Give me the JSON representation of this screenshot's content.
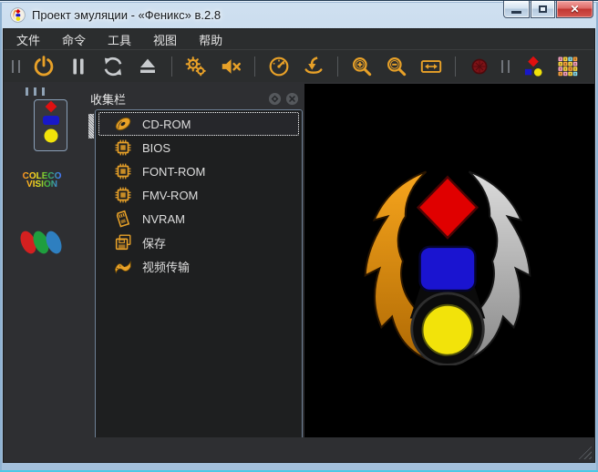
{
  "window": {
    "title": "Проект эмуляции - «Феникс» в.2.8",
    "app_icon": "phoenix-app-icon",
    "controls": [
      {
        "name": "minimize",
        "icon": "minimize-icon"
      },
      {
        "name": "maximize",
        "icon": "maximize-icon"
      },
      {
        "name": "close",
        "icon": "close-icon"
      }
    ]
  },
  "menu_bar": {
    "items": [
      {
        "label": "文件"
      },
      {
        "label": "命令"
      },
      {
        "label": "工具"
      },
      {
        "label": "视图"
      },
      {
        "label": "帮助"
      }
    ]
  },
  "toolbar": {
    "items": [
      {
        "type": "grip"
      },
      {
        "type": "button",
        "name": "power",
        "icon": "power-icon"
      },
      {
        "type": "button",
        "name": "pause",
        "icon": "pause-icon"
      },
      {
        "type": "button",
        "name": "reset",
        "icon": "refresh-icon"
      },
      {
        "type": "button",
        "name": "eject",
        "icon": "eject-icon"
      },
      {
        "type": "separator"
      },
      {
        "type": "button",
        "name": "settings",
        "icon": "gears-icon"
      },
      {
        "type": "button",
        "name": "mute",
        "icon": "mute-icon"
      },
      {
        "type": "separator"
      },
      {
        "type": "button",
        "name": "speed",
        "icon": "gauge-icon"
      },
      {
        "type": "button",
        "name": "load",
        "icon": "download-icon"
      },
      {
        "type": "separator"
      },
      {
        "type": "button",
        "name": "zoom-in",
        "icon": "zoom-in-icon"
      },
      {
        "type": "button",
        "name": "zoom-out",
        "icon": "zoom-out-icon"
      },
      {
        "type": "button",
        "name": "fit-window",
        "icon": "expand-icon"
      },
      {
        "type": "separator"
      },
      {
        "type": "button",
        "name": "record",
        "icon": "record-icon"
      },
      {
        "type": "grip"
      },
      {
        "type": "button",
        "name": "phoenix-shapes",
        "icon": "shapes-icon"
      },
      {
        "type": "button",
        "name": "keypad",
        "icon": "keypad-icon"
      }
    ]
  },
  "sidebar": {
    "items": [
      {
        "name": "phoenix-system",
        "icon": "phoenix-shapes-stack-icon",
        "selected": true
      },
      {
        "name": "colecovision-system",
        "logo_line1": "COLECO",
        "logo_line2": "VISION",
        "selected": false
      },
      {
        "name": "ovals-system",
        "icon": "three-ovals-icon",
        "selected": false
      }
    ]
  },
  "panel": {
    "title": "收集栏",
    "buttons": [
      {
        "name": "float",
        "icon": "float-icon"
      },
      {
        "name": "close",
        "icon": "panel-close-icon"
      }
    ],
    "items": [
      {
        "icon": "cd-icon",
        "label": "CD-ROM",
        "selected": true
      },
      {
        "icon": "chip-icon",
        "label": "BIOS",
        "selected": false
      },
      {
        "icon": "chip-icon",
        "label": "FONT-ROM",
        "selected": false
      },
      {
        "icon": "chip-icon",
        "label": "FMV-ROM",
        "selected": false
      },
      {
        "icon": "memory-card-icon",
        "label": "NVRAM",
        "selected": false
      },
      {
        "icon": "save-icon",
        "label": "保存",
        "selected": false
      },
      {
        "icon": "film-icon",
        "label": "视频传输",
        "selected": false
      }
    ]
  },
  "canvas": {
    "logo": "phoenix-logo"
  },
  "colors": {
    "accent_orange": "#E8A128",
    "titlebar_blue": "#B3CCE5",
    "menu_bg": "#2B2D2E",
    "client_bg": "#2E2F32",
    "panel_list_bg": "#1E1F20",
    "canvas_bg": "#000000",
    "selection_border": "#FFFFFF",
    "close_red": "#C23732",
    "logo_red": "#E00000",
    "logo_blue": "#1A14D0",
    "logo_yellow": "#F2E30A",
    "wing_orange": "#E08A10",
    "wing_silver": "#B8B8B8"
  }
}
